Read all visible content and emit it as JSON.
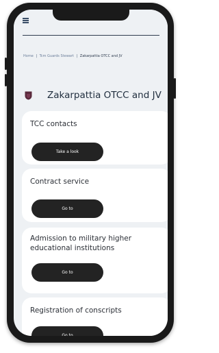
{
  "header": {
    "menu_icon": "hamburger-menu-icon"
  },
  "breadcrumb": {
    "items": [
      "Home",
      "Tcm Guards Stewart"
    ],
    "current": "Zakarpattia OTCC and JV",
    "separator": "|"
  },
  "page": {
    "title": "Zakarpattia OTCC and JV",
    "emblem_icon": "coat-of-arms-shield-icon",
    "emblem_color": "#5a2a3c"
  },
  "cards": [
    {
      "title": "TCC contacts",
      "button": "Take a look"
    },
    {
      "title": "Contract service",
      "button": "Go to"
    },
    {
      "title": "Admission to military higher educational institutions",
      "button": "Go to"
    },
    {
      "title": "Registration of conscripts",
      "button": "Go to"
    }
  ],
  "colors": {
    "screen_bg": "#eef1f4",
    "card_bg": "#ffffff",
    "button_bg": "#232323",
    "frame": "#1a1a1a"
  }
}
